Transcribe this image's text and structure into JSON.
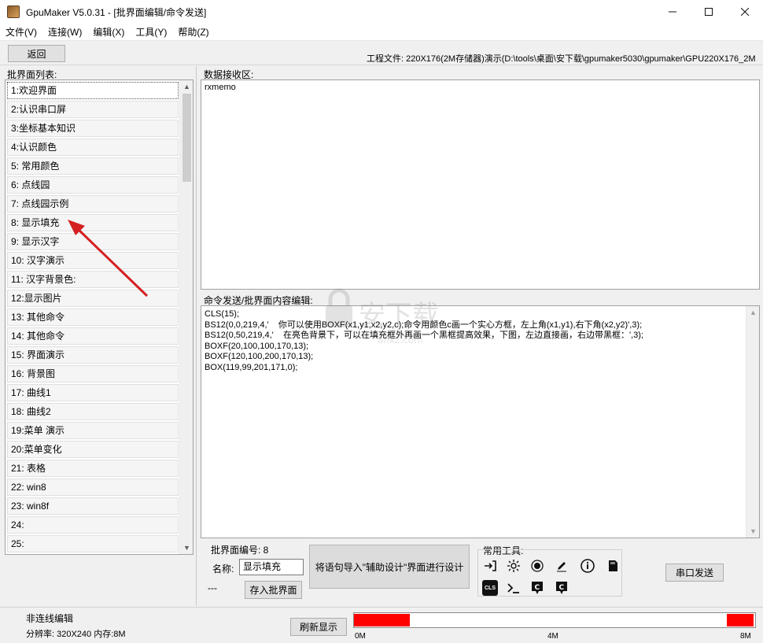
{
  "window": {
    "title": "GpuMaker V5.0.31 - [批界面编辑/命令发送]",
    "min_label": "—",
    "max_label": "☐",
    "close_label": "✕"
  },
  "menu": [
    "文件(V)",
    "连接(W)",
    "编辑(X)",
    "工具(Y)",
    "帮助(Z)"
  ],
  "toolbar": {
    "back_label": "返回",
    "project_file": "工程文件:  220X176(2M存储器)演示(D:\\tools\\桌面\\安下载\\gpumaker5030\\gpumaker\\GPU220X176_2M"
  },
  "left_panel": {
    "label": "批界面列表:",
    "items": [
      "1:欢迎界面",
      "2:认识串口屏",
      "3:坐标基本知识",
      "4:认识颜色",
      "5: 常用颜色",
      "6: 点线园",
      "7: 点线园示例",
      "8: 显示填充",
      "9: 显示汉字",
      "10: 汉字演示",
      "11: 汉字背景色:",
      "12:显示图片",
      "13: 其他命令",
      "14: 其他命令",
      "15: 界面演示",
      "16: 背景图",
      "17: 曲线1",
      "18: 曲线2",
      "19:菜单 演示",
      "20:菜单变化",
      "21: 表格",
      "22: win8",
      "23: win8f",
      "24:",
      "25:"
    ],
    "selected_index": 0
  },
  "receive": {
    "label": "数据接收区:",
    "content": "rxmemo"
  },
  "editor": {
    "label": "命令发送/批界面内容编辑:",
    "lines": [
      "CLS(15);",
      "BS12(0,0,219,4,'    你可以使用BOXF(x1,y1,x2,y2,c);命令用颜色c画一个实心方框，左上角(x1,y1),右下角(x2,y2)',3);",
      "BS12(0,50,219,4,'    在亮色背景下，可以在填充框外再画一个黑框提高效果，下图，左边直接画，右边带黑框：',3);",
      "BOXF(20,100,100,170,13);",
      "BOXF(120,100,200,170,13);",
      "BOX(119,99,201,171,0);"
    ]
  },
  "bottom": {
    "batch_number_label": "批界面编号:  8",
    "name_label": "名称:",
    "name_value": "显示填充",
    "dashes": "---",
    "save_button": "存入批界面",
    "import_button": "将语句导入\"辅助设计\"界面进行设计",
    "tools_label": "常用工具:",
    "send_button": "串口发送",
    "tool_icons": [
      "enter-icon",
      "brightness-icon",
      "record-icon",
      "pencil-icon",
      "info-icon",
      "sd-card-icon",
      "cls-icon",
      "terminal-icon",
      "c-bubble-icon",
      "c-bubble-alt-icon"
    ]
  },
  "status": {
    "mode": "非连线编辑",
    "resolution": "分辨率: 320X240   内存:8M",
    "refresh_button": "刷新显示",
    "memory_used_start_fraction": 0.14,
    "memory_used_end_fraction": 0.93,
    "mem_labels": [
      "0M",
      "4M",
      "8M"
    ],
    "fill_color": "#ff0000"
  },
  "watermark": {
    "text": "安下载",
    "subtext": "anxz.com"
  }
}
